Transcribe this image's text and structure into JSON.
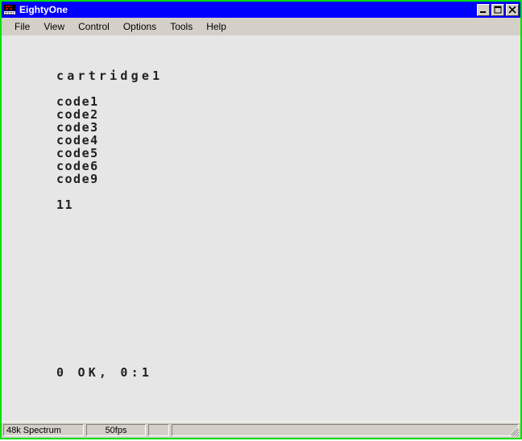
{
  "window": {
    "title": "EightyOne",
    "icon": "zx-computer-icon",
    "border_color": "#00e000",
    "titlebar_color": "#0000ff",
    "chrome_color": "#d4d0c8"
  },
  "window_controls": [
    {
      "name": "minimize",
      "glyph": "_"
    },
    {
      "name": "maximize",
      "glyph": "□"
    },
    {
      "name": "close",
      "glyph": "×"
    }
  ],
  "menu": {
    "items": [
      {
        "label": "File"
      },
      {
        "label": "View"
      },
      {
        "label": "Control"
      },
      {
        "label": "Options"
      },
      {
        "label": "Tools"
      },
      {
        "label": "Help"
      }
    ]
  },
  "screen": {
    "background_color": "#e6e6e6",
    "ink_color": "#202020",
    "lines": [
      {
        "text": "cartridge1",
        "spacing": "wide"
      },
      {
        "text": "",
        "spacing": "blank"
      },
      {
        "text": "code1",
        "spacing": "normal"
      },
      {
        "text": "code2",
        "spacing": "normal"
      },
      {
        "text": "code3",
        "spacing": "normal"
      },
      {
        "text": "code4",
        "spacing": "normal"
      },
      {
        "text": "code5",
        "spacing": "normal"
      },
      {
        "text": "code6",
        "spacing": "normal"
      },
      {
        "text": "code9",
        "spacing": "normal"
      },
      {
        "text": "",
        "spacing": "blank"
      },
      {
        "text": "11",
        "spacing": "normal"
      }
    ],
    "status_message": "0 OK, 0:1"
  },
  "status_bar": {
    "panels": [
      {
        "name": "machine-model",
        "text": "48k Spectrum"
      },
      {
        "name": "frame-rate",
        "text": "50fps"
      },
      {
        "name": "indicator",
        "text": ""
      },
      {
        "name": "message",
        "text": ""
      }
    ],
    "resize_grip": "resize-grip-icon"
  }
}
